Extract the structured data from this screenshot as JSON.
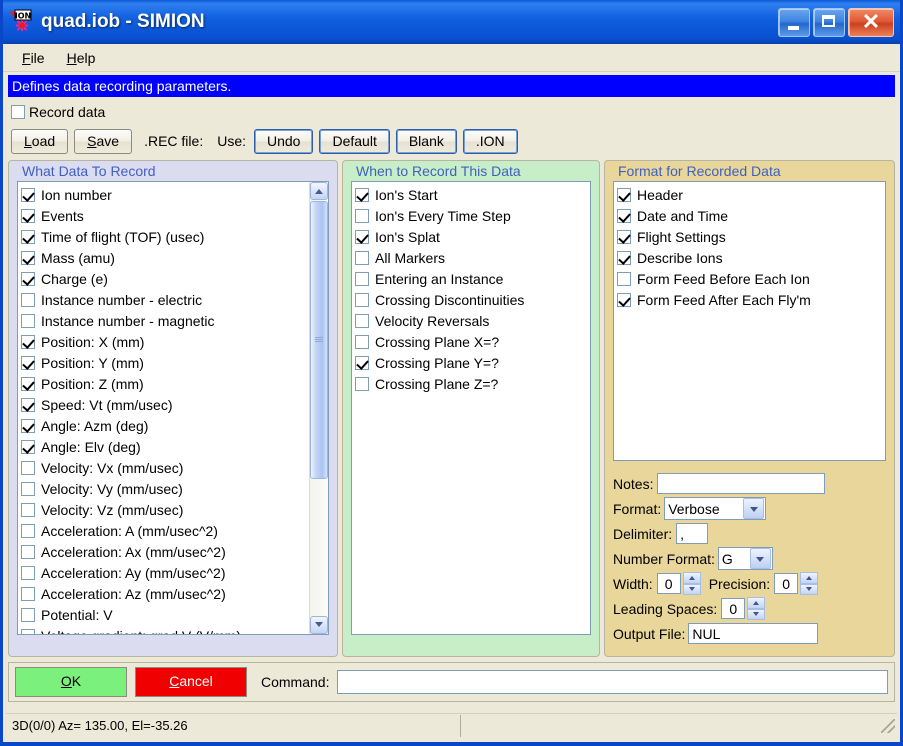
{
  "window": {
    "title": "quad.iob - SIMION",
    "icon": "ion-app-icon",
    "minimize_label": "Minimize",
    "maximize_label": "Maximize",
    "close_label": "Close"
  },
  "menubar": {
    "items": [
      {
        "label": "File",
        "mnemonic": "F"
      },
      {
        "label": "Help",
        "mnemonic": "H"
      }
    ]
  },
  "infobar": {
    "text": "Defines data recording parameters."
  },
  "record_row": {
    "checkbox_label": "Record data",
    "checked": false
  },
  "toolbar": {
    "load_label": "Load",
    "save_label": "Save",
    "rec_file_label": ".REC file:",
    "use_label": "Use:",
    "undo_label": "Undo",
    "default_label": "Default",
    "blank_label": "Blank",
    "ion_label": ".ION"
  },
  "what_to_record": {
    "legend": "What Data To Record",
    "items": [
      {
        "label": "Ion number",
        "checked": true
      },
      {
        "label": "Events",
        "checked": true
      },
      {
        "label": "Time of flight (TOF) (usec)",
        "checked": true
      },
      {
        "label": "Mass (amu)",
        "checked": true
      },
      {
        "label": "Charge (e)",
        "checked": true
      },
      {
        "label": "Instance number - electric",
        "checked": false
      },
      {
        "label": "Instance number - magnetic",
        "checked": false
      },
      {
        "label": "Position: X (mm)",
        "checked": true
      },
      {
        "label": "Position: Y (mm)",
        "checked": true
      },
      {
        "label": "Position: Z (mm)",
        "checked": true
      },
      {
        "label": "Speed: Vt (mm/usec)",
        "checked": true
      },
      {
        "label": "Angle: Azm (deg)",
        "checked": true
      },
      {
        "label": "Angle: Elv (deg)",
        "checked": true
      },
      {
        "label": "Velocity: Vx (mm/usec)",
        "checked": false
      },
      {
        "label": "Velocity: Vy (mm/usec)",
        "checked": false
      },
      {
        "label": "Velocity: Vz (mm/usec)",
        "checked": false
      },
      {
        "label": "Acceleration: A (mm/usec^2)",
        "checked": false
      },
      {
        "label": "Acceleration: Ax (mm/usec^2)",
        "checked": false
      },
      {
        "label": "Acceleration: Ay (mm/usec^2)",
        "checked": false
      },
      {
        "label": "Acceleration: Az (mm/usec^2)",
        "checked": false
      },
      {
        "label": "Potential: V",
        "checked": false
      },
      {
        "label": "Voltage gradient: grad V (V/mm)",
        "checked": false
      }
    ]
  },
  "when_to_record": {
    "legend": "When to Record This Data",
    "items": [
      {
        "label": "Ion's Start",
        "checked": true
      },
      {
        "label": "Ion's Every Time Step",
        "checked": false
      },
      {
        "label": "Ion's Splat",
        "checked": true
      },
      {
        "label": "All Markers",
        "checked": false
      },
      {
        "label": "Entering an Instance",
        "checked": false
      },
      {
        "label": "Crossing Discontinuities",
        "checked": false
      },
      {
        "label": "Velocity Reversals",
        "checked": false
      },
      {
        "label": "Crossing Plane X=?",
        "checked": false
      },
      {
        "label": "Crossing Plane Y=?",
        "checked": true
      },
      {
        "label": "Crossing Plane Z=?",
        "checked": false
      }
    ]
  },
  "format_panel": {
    "legend": "Format for Recorded Data",
    "items": [
      {
        "label": "Header",
        "checked": true
      },
      {
        "label": "Date and Time",
        "checked": true
      },
      {
        "label": "Flight Settings",
        "checked": true
      },
      {
        "label": "Describe Ions",
        "checked": true
      },
      {
        "label": "Form Feed Before Each Ion",
        "checked": false
      },
      {
        "label": "Form Feed After Each Fly'm",
        "checked": true
      }
    ],
    "notes_label": "Notes:",
    "notes_value": "",
    "format_label": "Format:",
    "format_value": "Verbose",
    "delimiter_label": "Delimiter:",
    "delimiter_value": ",",
    "number_format_label": "Number Format:",
    "number_format_value": "G",
    "width_label": "Width:",
    "width_value": "0",
    "precision_label": "Precision:",
    "precision_value": "0",
    "leading_spaces_label": "Leading Spaces:",
    "leading_spaces_value": "0",
    "output_file_label": "Output File:",
    "output_file_value": "NUL"
  },
  "actionbar": {
    "ok_label": "OK",
    "ok_mnemonic": "O",
    "cancel_label": "Cancel",
    "cancel_mnemonic": "C",
    "command_label": "Command:",
    "command_value": ""
  },
  "statusbar": {
    "left_text": "3D(0/0) Az= 135.00, El=-35.26",
    "right_text": ""
  },
  "colors": {
    "titlebar_blue": "#0a4fd0",
    "infobar_blue": "#0000ff",
    "panel_left": "#dcdcf0",
    "panel_mid": "#c8eec8",
    "panel_right": "#e8d69a",
    "legend_text": "#4060c0",
    "ok_green": "#7cf07c",
    "cancel_red": "#f00000"
  }
}
